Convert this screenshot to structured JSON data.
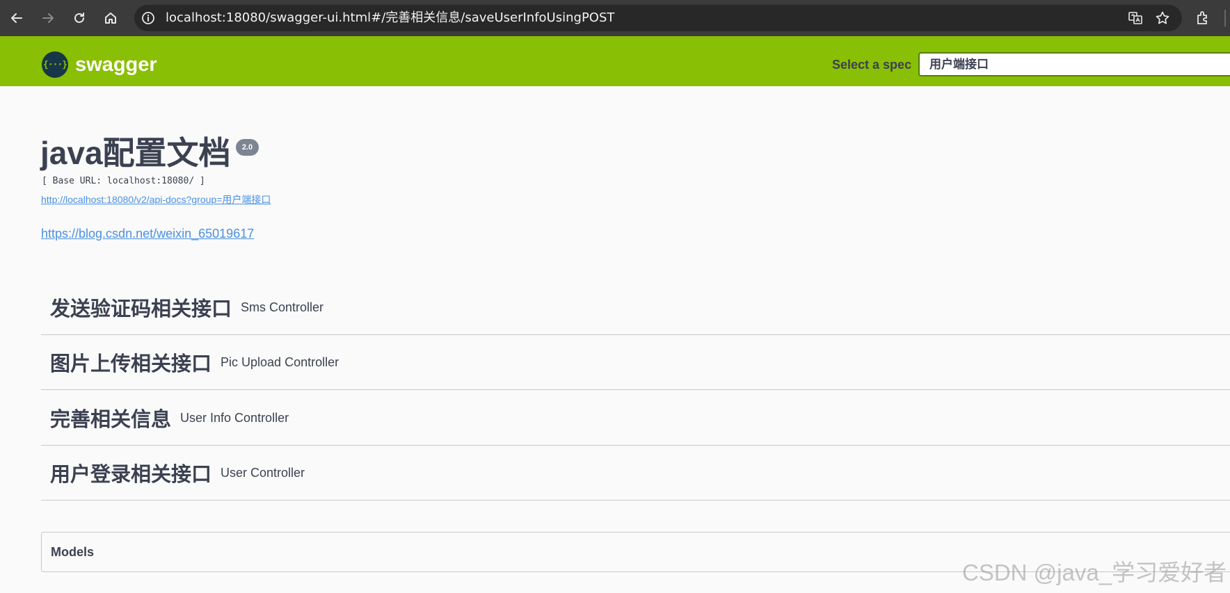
{
  "browser": {
    "url": "localhost:18080/swagger-ui.html#/完善相关信息/saveUserInfoUsingPOST"
  },
  "swagger": {
    "logo_text": "swagger",
    "logo_glyph": "{···}",
    "spec_label": "Select a spec",
    "spec_selected": "用户端接口",
    "brand_color": "#89bf04"
  },
  "info": {
    "title": "java配置文档",
    "version": "2.0",
    "base_url": "[ Base URL: localhost:18080/ ]",
    "docs_url": "http://localhost:18080/v2/api-docs?group=用户端接口",
    "blog_url": "https://blog.csdn.net/weixin_65019617"
  },
  "tags": [
    {
      "name": "发送验证码相关接口",
      "description": "Sms Controller"
    },
    {
      "name": "图片上传相关接口",
      "description": "Pic Upload Controller"
    },
    {
      "name": "完善相关信息",
      "description": "User Info Controller"
    },
    {
      "name": "用户登录相关接口",
      "description": "User Controller"
    }
  ],
  "models": {
    "title": "Models"
  },
  "watermark": "CSDN @java_学习爱好者"
}
